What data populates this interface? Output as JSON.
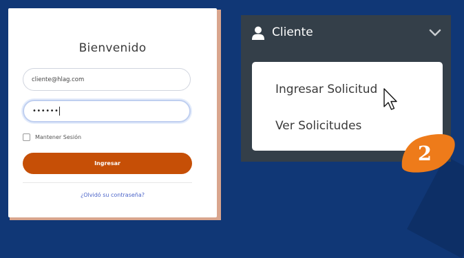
{
  "login": {
    "title": "Bienvenido",
    "email_value": "cliente@hlag.com",
    "password_value": "••••••",
    "remember_label": "Mantener Sesión",
    "submit_label": "Ingresar",
    "forgot_label": "¿Olvidó su contraseña?"
  },
  "menu": {
    "title": "Cliente",
    "items": [
      {
        "label": "Ingresar Solicitud"
      },
      {
        "label": "Ver Solicitudes"
      }
    ]
  },
  "badge": {
    "number": "2"
  },
  "colors": {
    "page_background": "#103776",
    "submit_button": "#c64f06",
    "menu_background": "#343f49",
    "badge": "#ee7b1a",
    "link": "#4a63c8"
  },
  "icons": [
    "user-icon",
    "chevron-down-icon",
    "mouse-pointer-icon"
  ]
}
